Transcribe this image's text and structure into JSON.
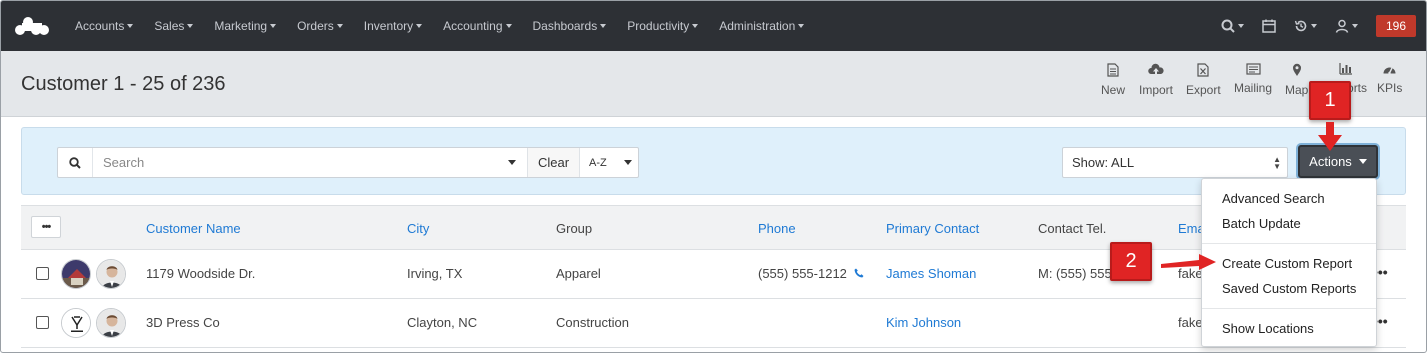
{
  "nav": {
    "items": [
      "Accounts",
      "Sales",
      "Marketing",
      "Orders",
      "Inventory",
      "Accounting",
      "Dashboards",
      "Productivity",
      "Administration"
    ],
    "badge": "196",
    "icons": [
      "search-icon",
      "calendar-icon",
      "history-icon",
      "user-icon"
    ]
  },
  "header": {
    "title": "Customer 1 - 25 of 236",
    "toolbar": [
      {
        "label": "New",
        "icon": "document-icon"
      },
      {
        "label": "Import",
        "icon": "cloud-upload-icon"
      },
      {
        "label": "Export",
        "icon": "excel-export-icon"
      },
      {
        "label": "Mailing",
        "icon": "mailing-icon"
      },
      {
        "label": "Map",
        "icon": "map-pin-icon"
      },
      {
        "label": "Reports",
        "icon": "bar-chart-icon"
      },
      {
        "label": "KPIs",
        "icon": "gauge-icon"
      }
    ]
  },
  "filter": {
    "search_placeholder": "Search",
    "clear_label": "Clear",
    "sort_label": "A-Z",
    "show_label": "Show: ALL",
    "actions_label": "Actions"
  },
  "table": {
    "columns": [
      "Customer Name",
      "City",
      "Group",
      "Phone",
      "Primary Contact",
      "Contact Tel.",
      "Email"
    ],
    "rows": [
      {
        "name": "1179 Woodside Dr.",
        "city": "Irving, TX",
        "group": "Apparel",
        "phone": "(555) 555-1212",
        "contact": "James Shoman",
        "tel": "M: (555) 555",
        "email": "fake"
      },
      {
        "name": "3D Press Co",
        "city": "Clayton, NC",
        "group": "Construction",
        "phone": "",
        "contact": "Kim Johnson",
        "tel": "",
        "email": "fake"
      }
    ]
  },
  "actions_menu": {
    "items": [
      "Advanced Search",
      "Batch Update",
      "Create Custom Report",
      "Saved Custom Reports",
      "Show Locations"
    ]
  },
  "callouts": [
    "1",
    "2"
  ],
  "colors": {
    "nav_bg": "#2d3035",
    "badge": "#c0392b",
    "link": "#1f7ad4",
    "filter_bg": "#dff0fb",
    "callout": "#e02424"
  }
}
